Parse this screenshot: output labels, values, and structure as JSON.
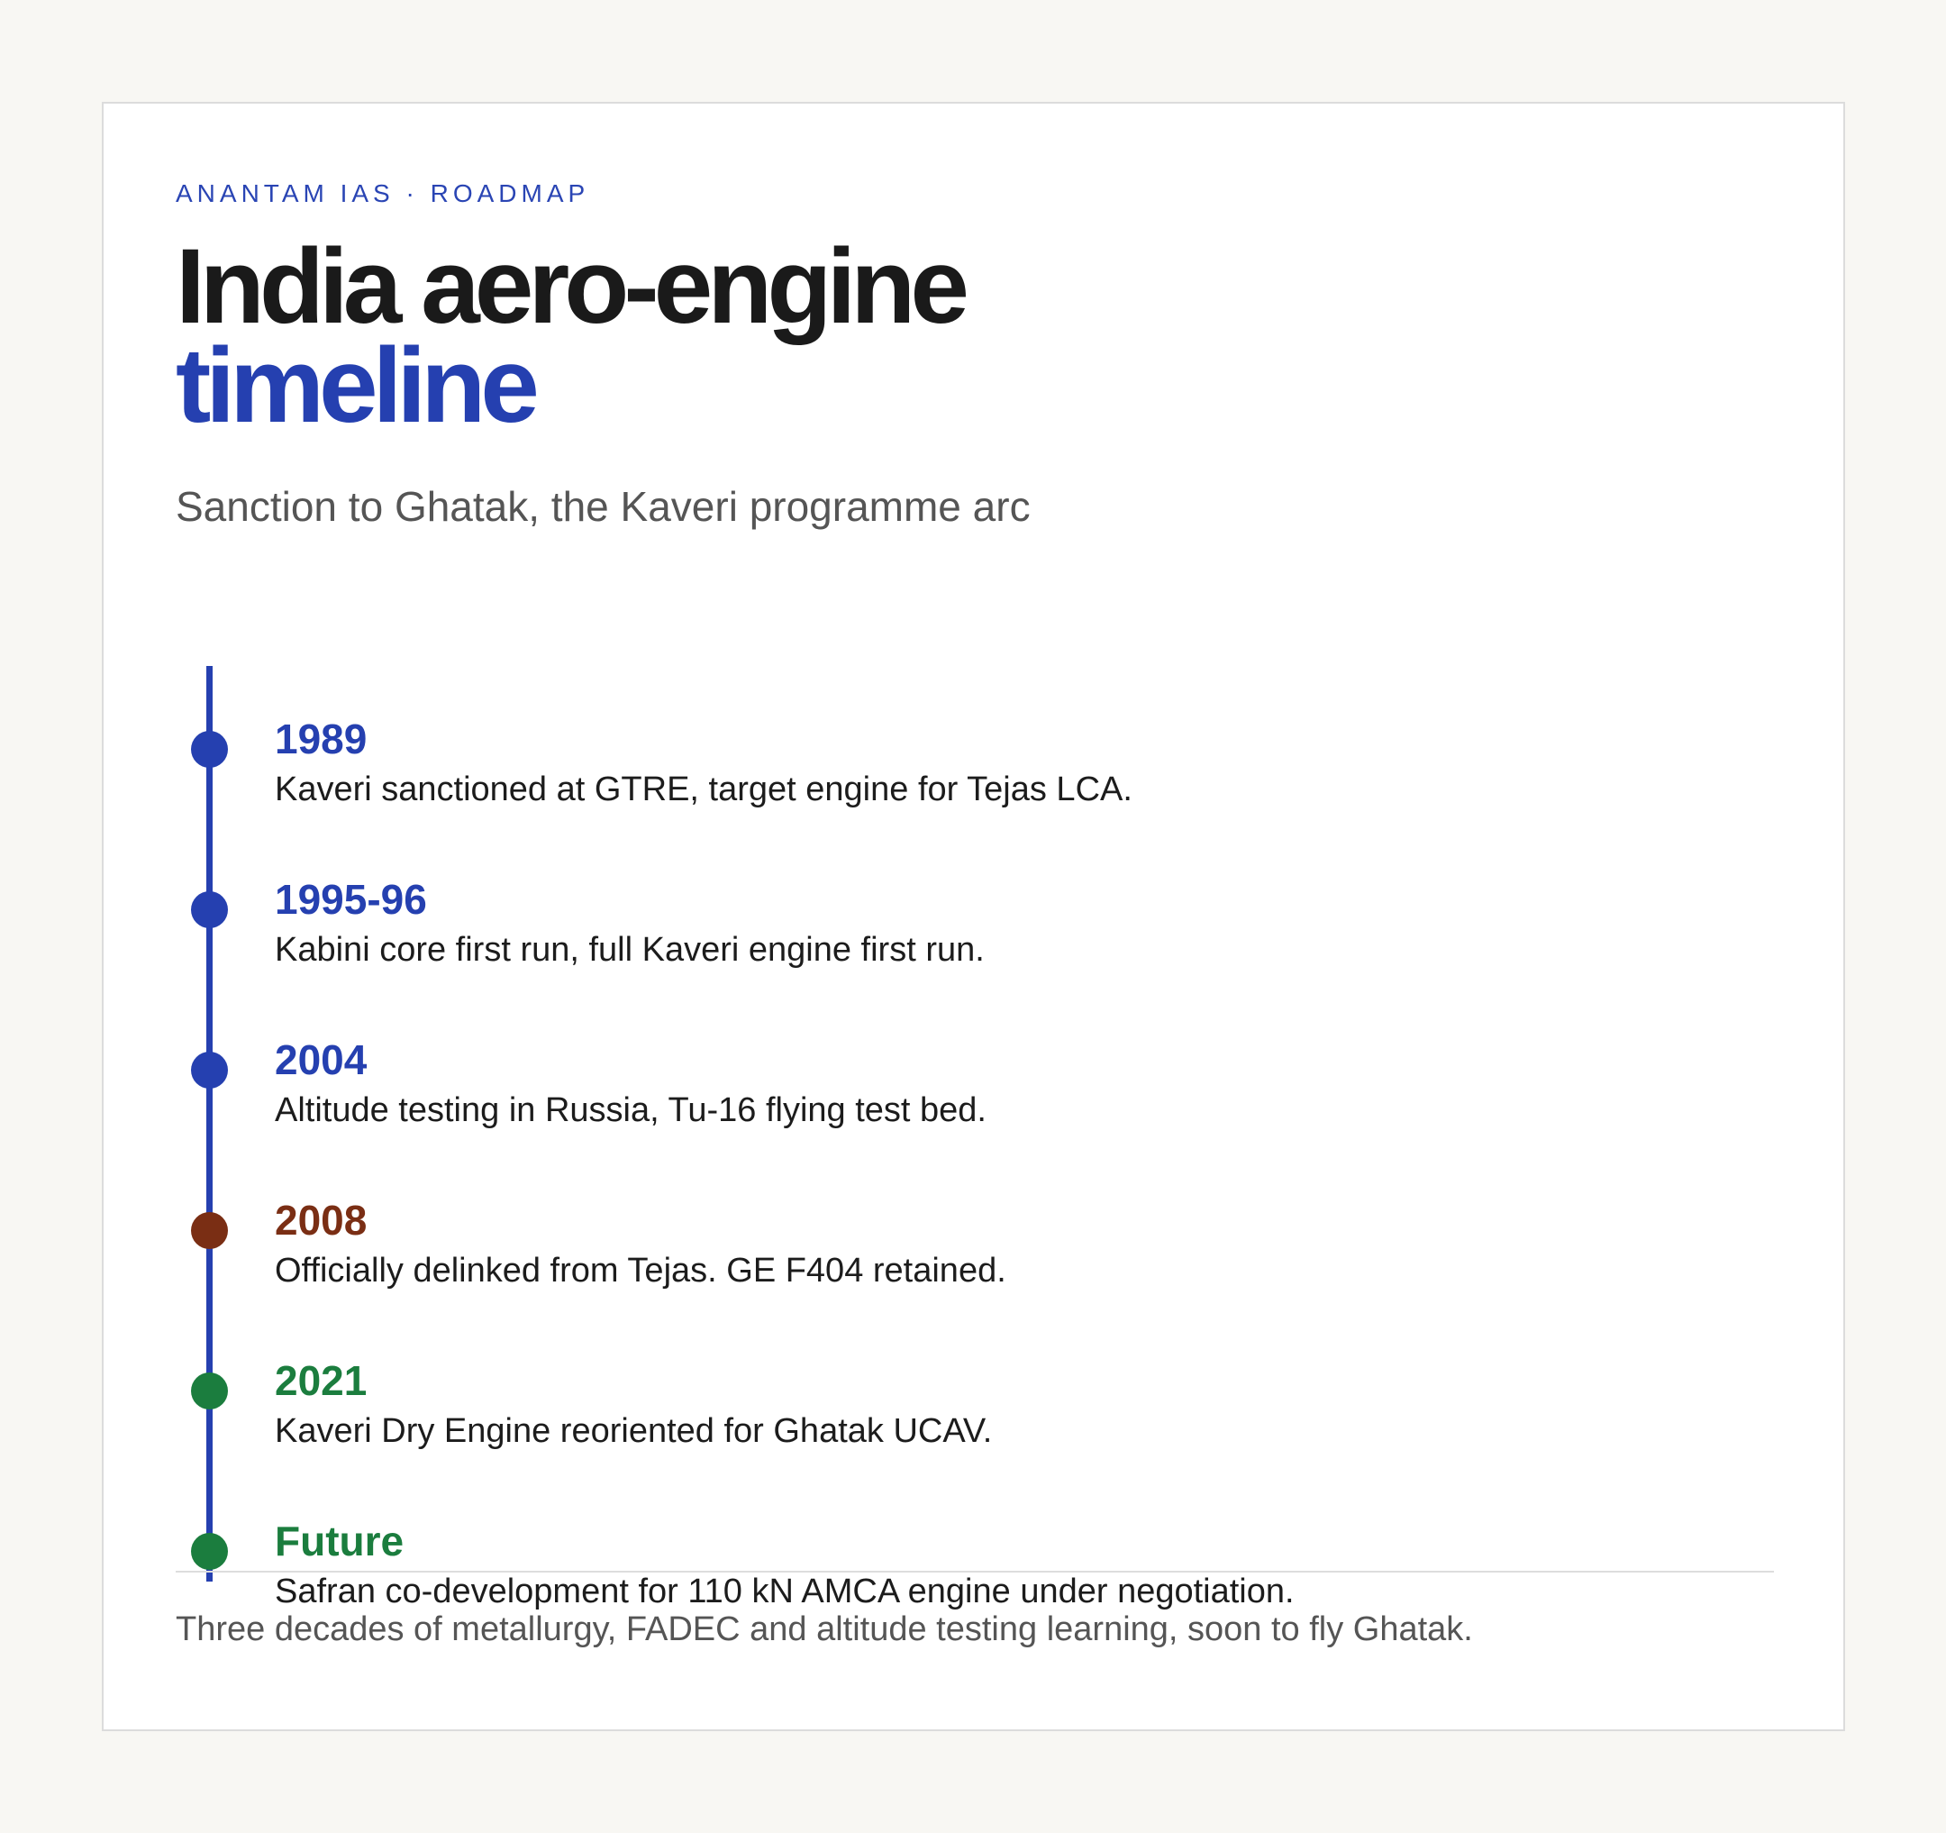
{
  "eyebrow": "ANANTAM IAS · ROADMAP",
  "title": {
    "line1": "India aero-engine",
    "line2": "timeline"
  },
  "subtitle": "Sanction to Ghatak, the Kaveri programme arc",
  "colors": {
    "blue": "#2540b0",
    "brown": "#7a2e14",
    "green": "#1b7d3e",
    "text": "#1c1c1c",
    "muted": "#555555"
  },
  "timeline": [
    {
      "year": "1989",
      "text": "Kaveri sanctioned at GTRE, target engine for Tejas LCA.",
      "color": "#2540b0"
    },
    {
      "year": "1995-96",
      "text": "Kabini core first run, full Kaveri engine first run.",
      "color": "#2540b0"
    },
    {
      "year": "2004",
      "text": "Altitude testing in Russia, Tu-16 flying test bed.",
      "color": "#2540b0"
    },
    {
      "year": "2008",
      "text": "Officially delinked from Tejas. GE F404 retained.",
      "color": "#7a2e14"
    },
    {
      "year": "2021",
      "text": "Kaveri Dry Engine reoriented for Ghatak UCAV.",
      "color": "#1b7d3e"
    },
    {
      "year": "Future",
      "text": "Safran co-development for 110 kN AMCA engine under negotiation.",
      "color": "#1b7d3e"
    }
  ],
  "footer": "Three decades of metallurgy, FADEC and altitude testing learning, soon to fly Ghatak."
}
